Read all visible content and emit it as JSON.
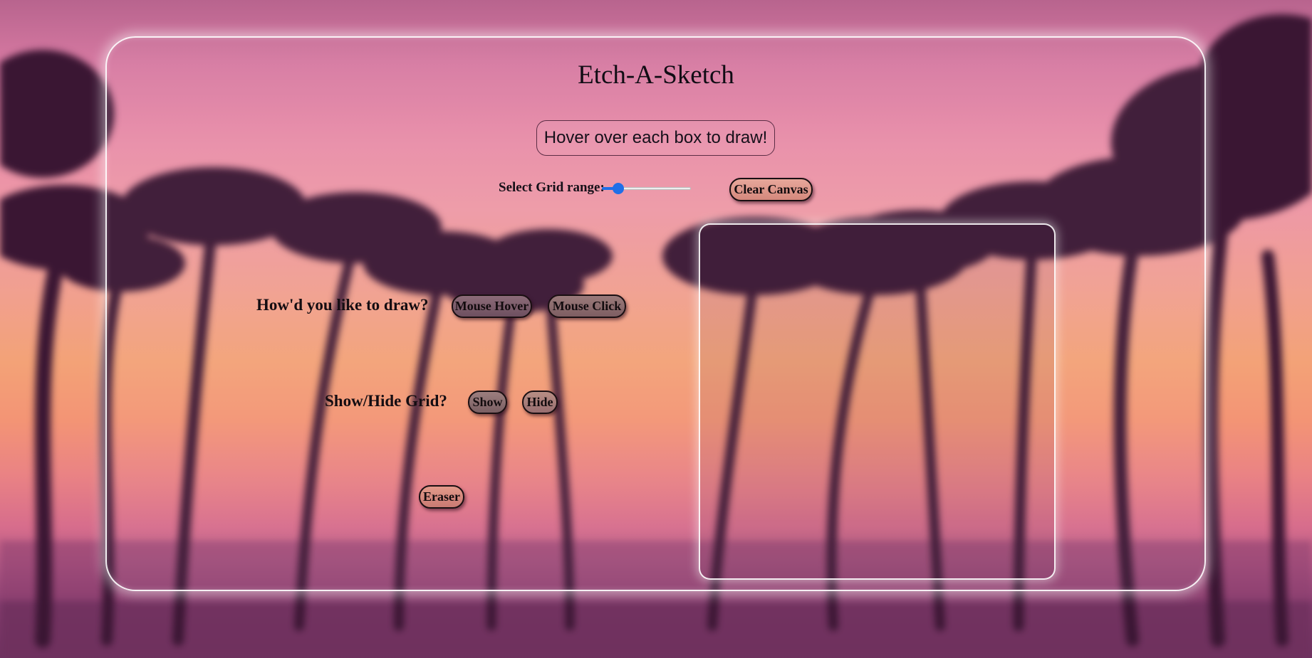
{
  "app": {
    "title": "Etch-A-Sketch",
    "hint": "Hover over each box to draw!"
  },
  "grid_range": {
    "label": "Select Grid range:",
    "value_fraction": 0.18,
    "accent_color": "#1f6fe8"
  },
  "buttons": {
    "clear": "Clear Canvas",
    "mouse_hover": "Mouse Hover",
    "mouse_click": "Mouse Click",
    "show": "Show",
    "hide": "Hide",
    "eraser": "Eraser"
  },
  "labels": {
    "draw_mode": "How'd you like to draw?",
    "grid_toggle": "Show/Hide Grid?"
  },
  "theme": {
    "background": "sunset-palm-trees",
    "panel_border": "#ffffff"
  }
}
